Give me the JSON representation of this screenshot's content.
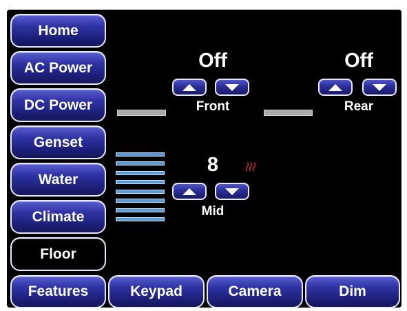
{
  "nav": {
    "items": [
      {
        "label": "Home",
        "active": false
      },
      {
        "label": "AC Power",
        "active": false
      },
      {
        "label": "DC Power",
        "active": false
      },
      {
        "label": "Genset",
        "active": false
      },
      {
        "label": "Water",
        "active": false
      },
      {
        "label": "Climate",
        "active": false
      },
      {
        "label": "Floor",
        "active": true
      },
      {
        "label": "Features",
        "active": false
      }
    ]
  },
  "bottom_bar": {
    "keypad": "Keypad",
    "camera": "Camera",
    "dim": "Dim"
  },
  "zones": {
    "front": {
      "status": "Off",
      "label": "Front"
    },
    "rear": {
      "status": "Off",
      "label": "Rear"
    },
    "mid": {
      "level": "8",
      "label": "Mid",
      "level_meter_segments": 8,
      "heating_icon": "heat-waves-icon",
      "heating_color": "#d9322a"
    }
  },
  "colors": {
    "button_blue": "#2f33a4",
    "panel_bg": "#000000",
    "meter_blue": "#5b9bd5",
    "idle_bar": "#a9a9a9"
  }
}
